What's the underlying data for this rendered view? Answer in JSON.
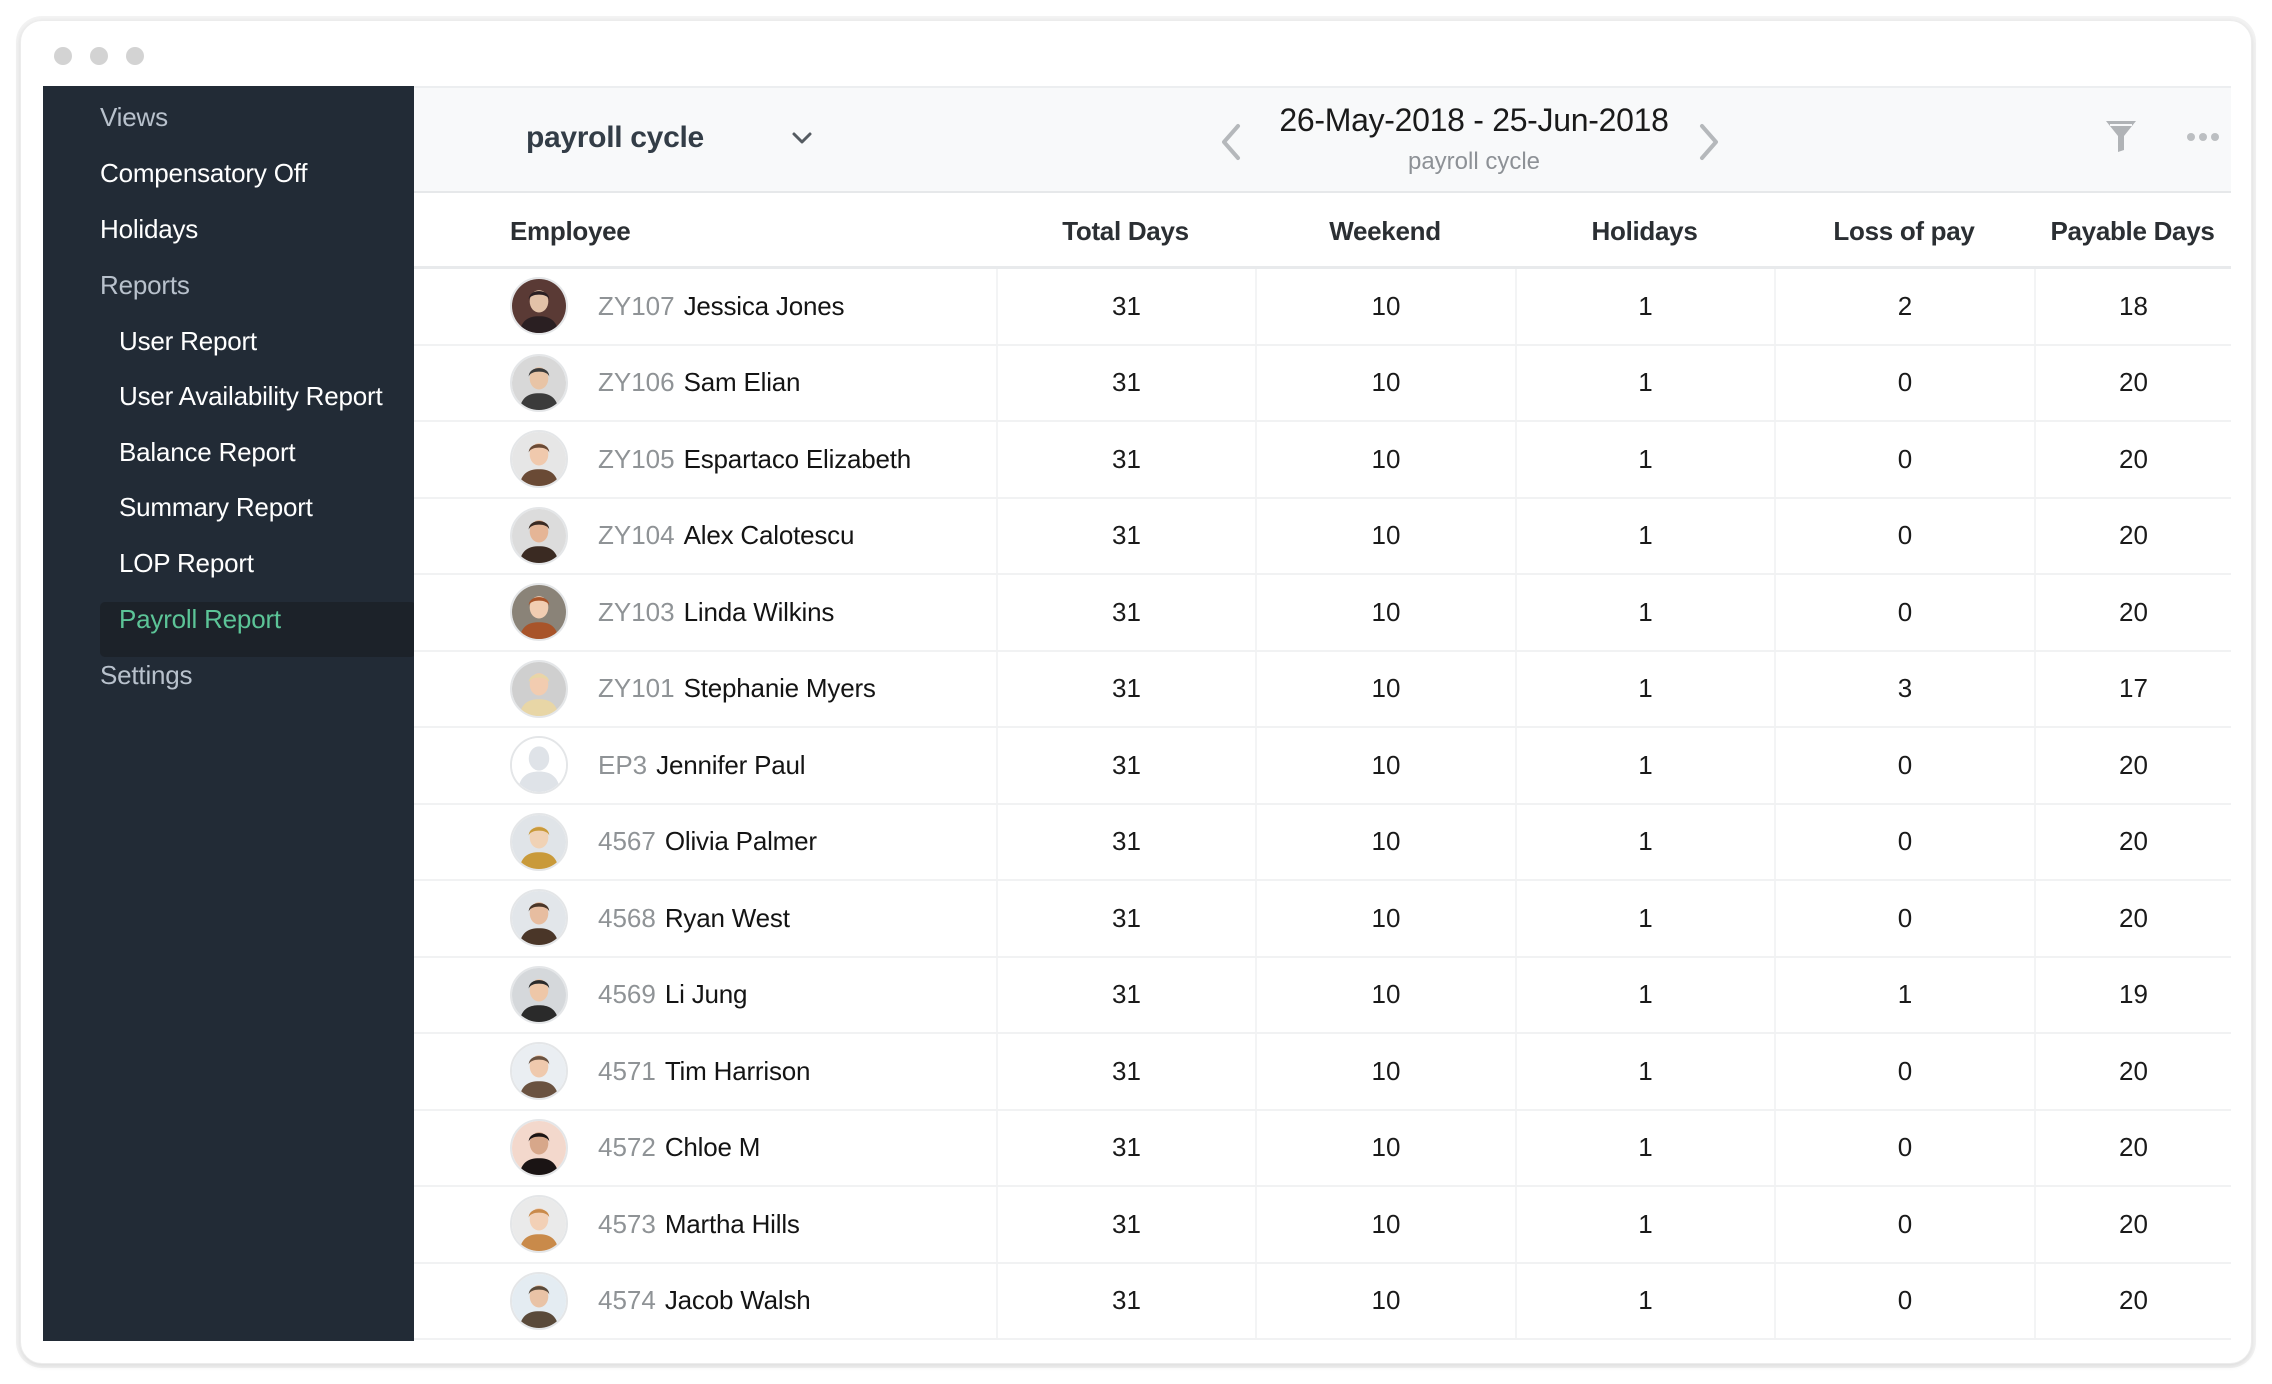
{
  "window": {
    "controls": [
      "close",
      "minimize",
      "maximize"
    ]
  },
  "sidebar": {
    "items": [
      {
        "label": "Views",
        "type": "section"
      },
      {
        "label": "Compensatory Off",
        "type": "item"
      },
      {
        "label": "Holidays",
        "type": "item"
      },
      {
        "label": "Reports",
        "type": "section"
      },
      {
        "label": "User Report",
        "type": "sub"
      },
      {
        "label": "User Availability Report",
        "type": "sub"
      },
      {
        "label": "Balance Report",
        "type": "sub"
      },
      {
        "label": "Summary Report",
        "type": "sub"
      },
      {
        "label": "LOP Report",
        "type": "sub"
      },
      {
        "label": "Payroll Report",
        "type": "sub",
        "active": true
      },
      {
        "label": "Settings",
        "type": "section"
      }
    ],
    "active_color": "#5cc497"
  },
  "toolbar": {
    "cycle_select": "payroll cycle",
    "date_range": "26-May-2018 - 25-Jun-2018",
    "date_subtitle": "payroll cycle",
    "icons": {
      "dropdown": "chevron-down-icon",
      "prev": "chevron-left-icon",
      "next": "chevron-right-icon",
      "filter": "filter-icon",
      "more": "more-horizontal-icon"
    }
  },
  "table": {
    "columns": [
      "Employee",
      "Total Days",
      "Weekend",
      "Holidays",
      "Loss of pay",
      "Payable Days"
    ],
    "rows": [
      {
        "id": "ZY107",
        "name": "Jessica Jones",
        "total": "31",
        "weekend": "10",
        "holidays": "1",
        "lop": "2",
        "payable": "18",
        "avatar": "photo"
      },
      {
        "id": "ZY106",
        "name": "Sam Elian",
        "total": "31",
        "weekend": "10",
        "holidays": "1",
        "lop": "0",
        "payable": "20",
        "avatar": "photo"
      },
      {
        "id": "ZY105",
        "name": "Espartaco Elizabeth",
        "total": "31",
        "weekend": "10",
        "holidays": "1",
        "lop": "0",
        "payable": "20",
        "avatar": "photo"
      },
      {
        "id": "ZY104",
        "name": "Alex Calotescu",
        "total": "31",
        "weekend": "10",
        "holidays": "1",
        "lop": "0",
        "payable": "20",
        "avatar": "photo"
      },
      {
        "id": "ZY103",
        "name": "Linda Wilkins",
        "total": "31",
        "weekend": "10",
        "holidays": "1",
        "lop": "0",
        "payable": "20",
        "avatar": "photo"
      },
      {
        "id": "ZY101",
        "name": "Stephanie Myers",
        "total": "31",
        "weekend": "10",
        "holidays": "1",
        "lop": "3",
        "payable": "17",
        "avatar": "photo"
      },
      {
        "id": "EP3",
        "name": "Jennifer Paul",
        "total": "31",
        "weekend": "10",
        "holidays": "1",
        "lop": "0",
        "payable": "20",
        "avatar": "placeholder"
      },
      {
        "id": "4567",
        "name": "Olivia Palmer",
        "total": "31",
        "weekend": "10",
        "holidays": "1",
        "lop": "0",
        "payable": "20",
        "avatar": "photo"
      },
      {
        "id": "4568",
        "name": "Ryan West",
        "total": "31",
        "weekend": "10",
        "holidays": "1",
        "lop": "0",
        "payable": "20",
        "avatar": "photo"
      },
      {
        "id": "4569",
        "name": "Li Jung",
        "total": "31",
        "weekend": "10",
        "holidays": "1",
        "lop": "1",
        "payable": "19",
        "avatar": "photo"
      },
      {
        "id": "4571",
        "name": "Tim Harrison",
        "total": "31",
        "weekend": "10",
        "holidays": "1",
        "lop": "0",
        "payable": "20",
        "avatar": "photo"
      },
      {
        "id": "4572",
        "name": "Chloe M",
        "total": "31",
        "weekend": "10",
        "holidays": "1",
        "lop": "0",
        "payable": "20",
        "avatar": "photo"
      },
      {
        "id": "4573",
        "name": "Martha Hills",
        "total": "31",
        "weekend": "10",
        "holidays": "1",
        "lop": "0",
        "payable": "20",
        "avatar": "photo"
      },
      {
        "id": "4574",
        "name": "Jacob Walsh",
        "total": "31",
        "weekend": "10",
        "holidays": "1",
        "lop": "0",
        "payable": "20",
        "avatar": "photo"
      }
    ]
  }
}
